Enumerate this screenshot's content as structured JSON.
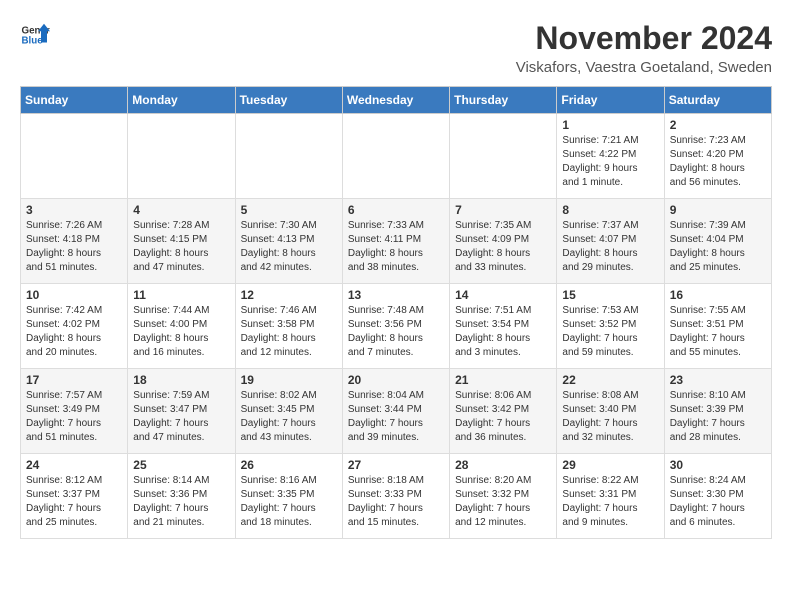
{
  "header": {
    "logo_general": "General",
    "logo_blue": "Blue",
    "month_year": "November 2024",
    "location": "Viskafors, Vaestra Goetaland, Sweden"
  },
  "weekdays": [
    "Sunday",
    "Monday",
    "Tuesday",
    "Wednesday",
    "Thursday",
    "Friday",
    "Saturday"
  ],
  "weeks": [
    [
      {
        "day": "",
        "info": ""
      },
      {
        "day": "",
        "info": ""
      },
      {
        "day": "",
        "info": ""
      },
      {
        "day": "",
        "info": ""
      },
      {
        "day": "",
        "info": ""
      },
      {
        "day": "1",
        "info": "Sunrise: 7:21 AM\nSunset: 4:22 PM\nDaylight: 9 hours\nand 1 minute."
      },
      {
        "day": "2",
        "info": "Sunrise: 7:23 AM\nSunset: 4:20 PM\nDaylight: 8 hours\nand 56 minutes."
      }
    ],
    [
      {
        "day": "3",
        "info": "Sunrise: 7:26 AM\nSunset: 4:18 PM\nDaylight: 8 hours\nand 51 minutes."
      },
      {
        "day": "4",
        "info": "Sunrise: 7:28 AM\nSunset: 4:15 PM\nDaylight: 8 hours\nand 47 minutes."
      },
      {
        "day": "5",
        "info": "Sunrise: 7:30 AM\nSunset: 4:13 PM\nDaylight: 8 hours\nand 42 minutes."
      },
      {
        "day": "6",
        "info": "Sunrise: 7:33 AM\nSunset: 4:11 PM\nDaylight: 8 hours\nand 38 minutes."
      },
      {
        "day": "7",
        "info": "Sunrise: 7:35 AM\nSunset: 4:09 PM\nDaylight: 8 hours\nand 33 minutes."
      },
      {
        "day": "8",
        "info": "Sunrise: 7:37 AM\nSunset: 4:07 PM\nDaylight: 8 hours\nand 29 minutes."
      },
      {
        "day": "9",
        "info": "Sunrise: 7:39 AM\nSunset: 4:04 PM\nDaylight: 8 hours\nand 25 minutes."
      }
    ],
    [
      {
        "day": "10",
        "info": "Sunrise: 7:42 AM\nSunset: 4:02 PM\nDaylight: 8 hours\nand 20 minutes."
      },
      {
        "day": "11",
        "info": "Sunrise: 7:44 AM\nSunset: 4:00 PM\nDaylight: 8 hours\nand 16 minutes."
      },
      {
        "day": "12",
        "info": "Sunrise: 7:46 AM\nSunset: 3:58 PM\nDaylight: 8 hours\nand 12 minutes."
      },
      {
        "day": "13",
        "info": "Sunrise: 7:48 AM\nSunset: 3:56 PM\nDaylight: 8 hours\nand 7 minutes."
      },
      {
        "day": "14",
        "info": "Sunrise: 7:51 AM\nSunset: 3:54 PM\nDaylight: 8 hours\nand 3 minutes."
      },
      {
        "day": "15",
        "info": "Sunrise: 7:53 AM\nSunset: 3:52 PM\nDaylight: 7 hours\nand 59 minutes."
      },
      {
        "day": "16",
        "info": "Sunrise: 7:55 AM\nSunset: 3:51 PM\nDaylight: 7 hours\nand 55 minutes."
      }
    ],
    [
      {
        "day": "17",
        "info": "Sunrise: 7:57 AM\nSunset: 3:49 PM\nDaylight: 7 hours\nand 51 minutes."
      },
      {
        "day": "18",
        "info": "Sunrise: 7:59 AM\nSunset: 3:47 PM\nDaylight: 7 hours\nand 47 minutes."
      },
      {
        "day": "19",
        "info": "Sunrise: 8:02 AM\nSunset: 3:45 PM\nDaylight: 7 hours\nand 43 minutes."
      },
      {
        "day": "20",
        "info": "Sunrise: 8:04 AM\nSunset: 3:44 PM\nDaylight: 7 hours\nand 39 minutes."
      },
      {
        "day": "21",
        "info": "Sunrise: 8:06 AM\nSunset: 3:42 PM\nDaylight: 7 hours\nand 36 minutes."
      },
      {
        "day": "22",
        "info": "Sunrise: 8:08 AM\nSunset: 3:40 PM\nDaylight: 7 hours\nand 32 minutes."
      },
      {
        "day": "23",
        "info": "Sunrise: 8:10 AM\nSunset: 3:39 PM\nDaylight: 7 hours\nand 28 minutes."
      }
    ],
    [
      {
        "day": "24",
        "info": "Sunrise: 8:12 AM\nSunset: 3:37 PM\nDaylight: 7 hours\nand 25 minutes."
      },
      {
        "day": "25",
        "info": "Sunrise: 8:14 AM\nSunset: 3:36 PM\nDaylight: 7 hours\nand 21 minutes."
      },
      {
        "day": "26",
        "info": "Sunrise: 8:16 AM\nSunset: 3:35 PM\nDaylight: 7 hours\nand 18 minutes."
      },
      {
        "day": "27",
        "info": "Sunrise: 8:18 AM\nSunset: 3:33 PM\nDaylight: 7 hours\nand 15 minutes."
      },
      {
        "day": "28",
        "info": "Sunrise: 8:20 AM\nSunset: 3:32 PM\nDaylight: 7 hours\nand 12 minutes."
      },
      {
        "day": "29",
        "info": "Sunrise: 8:22 AM\nSunset: 3:31 PM\nDaylight: 7 hours\nand 9 minutes."
      },
      {
        "day": "30",
        "info": "Sunrise: 8:24 AM\nSunset: 3:30 PM\nDaylight: 7 hours\nand 6 minutes."
      }
    ]
  ]
}
